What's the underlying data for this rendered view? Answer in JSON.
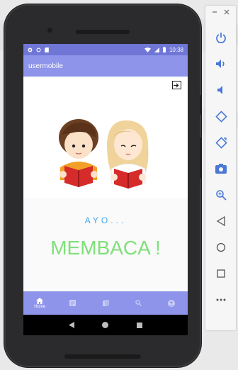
{
  "status_bar": {
    "time": "10:38"
  },
  "app": {
    "title": "usermobile",
    "greeting": "AYO...",
    "headline": "MEMBACA !"
  },
  "bottom_nav": {
    "active_label": "Home"
  },
  "colors": {
    "status_bar": "#6f76d6",
    "app_bar": "#8e94ea",
    "ayo_text": "#3fa6f2",
    "membaca_text": "#7fe07a",
    "toolbar_icon": "#4a78d6"
  },
  "icons": {
    "status_left": [
      "settings-icon",
      "circle-icon",
      "sd-card-icon"
    ],
    "status_right": [
      "wifi-icon",
      "signal-icon",
      "battery-icon"
    ],
    "bottom_nav": [
      "home-icon",
      "list-icon",
      "books-icon",
      "search-icon",
      "account-icon"
    ],
    "toolbar": [
      "power-icon",
      "volume-up-icon",
      "volume-down-icon",
      "rotate-left-icon",
      "rotate-right-icon",
      "camera-icon",
      "zoom-icon",
      "back-icon",
      "home-circle-icon",
      "overview-icon",
      "more-icon"
    ]
  }
}
